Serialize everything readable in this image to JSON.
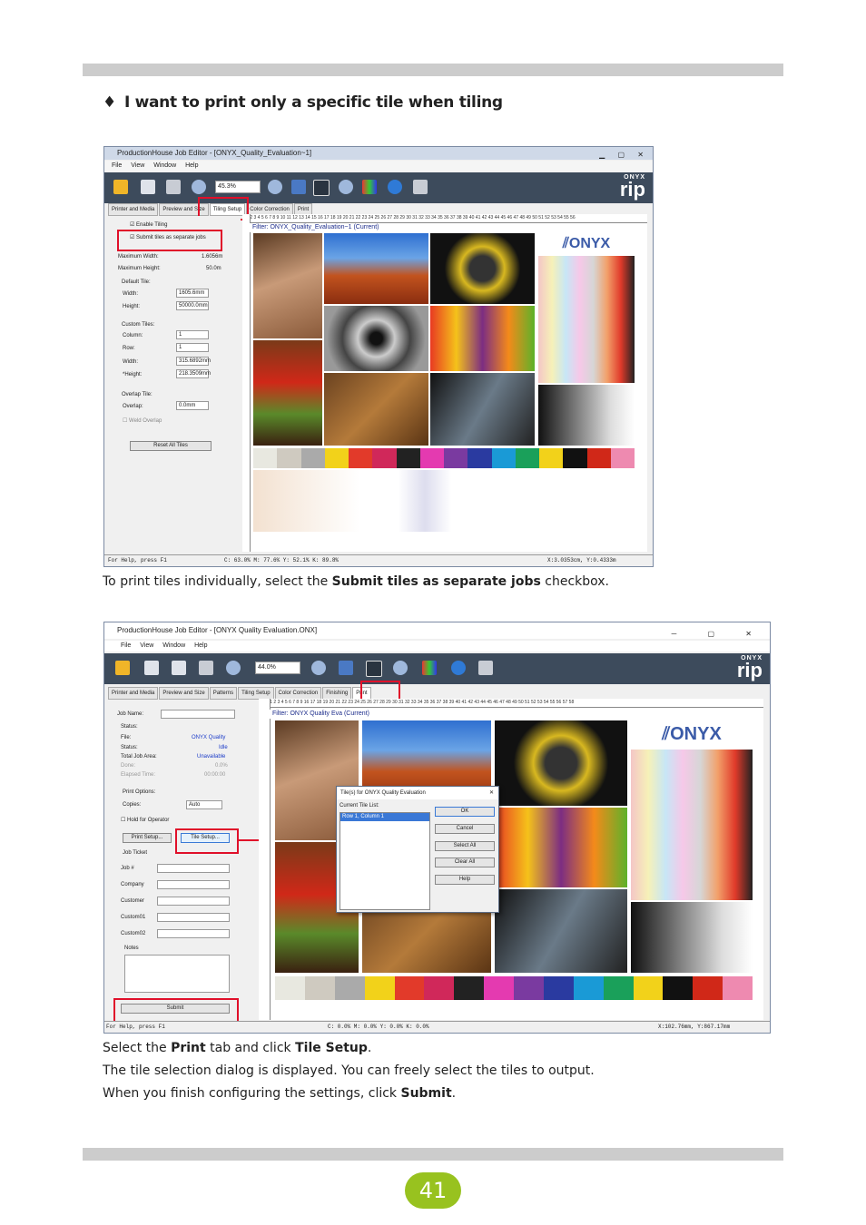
{
  "heading": {
    "bullet": "♦",
    "text": "I want to print only a specific tile when tiling"
  },
  "shot1": {
    "title": "ProductionHouse Job Editor - [ONYX_Quality_Evaluation~1]",
    "menu": [
      "File",
      "View",
      "Window",
      "Help"
    ],
    "zoom": "45.3%",
    "logo_brand": "ONYX",
    "logo_product": "rip",
    "tabs": [
      "Printer and Media",
      "Preview and Size",
      "Tiling Setup",
      "Color Correction",
      "Print"
    ],
    "enable_tiling": "Enable Tiling",
    "submit_tiles": "Submit tiles as separate jobs",
    "max_width_label": "Maximum Width:",
    "max_width": "1.6056m",
    "max_height_label": "Maximum Height:",
    "max_height": "50.0m",
    "default_tile": "Default Tile:",
    "width_label": "Width:",
    "width": "1605.6mm",
    "height_label": "Height:",
    "height": "50000.0mm",
    "custom_tiles": "Custom Tiles:",
    "column_label": "Column:",
    "column": "1",
    "row_label": "Row:",
    "row": "1",
    "cwidth_label": "Width:",
    "cwidth": "315.6892mm",
    "cheight_label": "*Height:",
    "cheight": "218.3509mm",
    "overlap_tile": "Overlap Tile:",
    "overlap_label": "Overlap:",
    "overlap": "0.0mm",
    "weld_overlap": "Weld Overlap",
    "reset": "Reset All Tiles",
    "ruler": "0 1 2 3 4 5 6 7 8 9 10 11 12 13 14 15 16 17 18 19 20 21 22 23 24 25 26 27 28 29 30 31 32 33 34 35 36 37 38 39 40 41 42 43 44 45 46 47 48 49 50 51 52 53 54 55 56",
    "filter": "Filter: ONYX_Quality_Evaluation~1 (Current)",
    "status_help": "For Help, press F1",
    "status_color": "C: 63.0% M: 77.6% Y: 52.1% K: 89.8%",
    "status_xy": "X:3.0353cm, Y:0.4333m"
  },
  "caption1": {
    "pre": "To print tiles individually, select the ",
    "bold": "Submit tiles as separate jobs",
    "post": " checkbox."
  },
  "shot2": {
    "title": "ProductionHouse Job Editor - [ONYX Quality Evaluation.ONX]",
    "menu": [
      "File",
      "View",
      "Window",
      "Help"
    ],
    "zoom": "44.0%",
    "logo_brand": "ONYX",
    "logo_product": "rip",
    "tabs": [
      "Printer and Media",
      "Preview and Size",
      "Patterns",
      "Tiling Setup",
      "Color Correction",
      "Finishing",
      "Print"
    ],
    "job_name": "Job Name:",
    "status_hdr": "Status:",
    "file_label": "File:",
    "file": "ONYX Quality",
    "status_label": "Status:",
    "status": "Idle",
    "total_label": "Total Job Area:",
    "total": "Unavailable",
    "done_label": "Done:",
    "done": "0.0%",
    "elapsed_label": "Elapsed Time:",
    "elapsed": "00:00:00",
    "print_options": "Print Options:",
    "copies_label": "Copies:",
    "copies": "Auto",
    "hold": "Hold for Operator",
    "print_setup": "Print Setup...",
    "tile_setup": "Tile Setup...",
    "job_ticket": "Job Ticket",
    "job_no": "Job #",
    "company": "Company",
    "customer": "Customer",
    "custom01": "Custom01",
    "custom02": "Custom02",
    "notes": "Notes",
    "submit": "Submit",
    "ruler": "cm 0 1 2 3 4 5 6 7 8 9 16 17 18 19 20 21 22 23 24 25 26 27 28 29 30 31 32 33 34 35 36 37 38 39 40 41 42 43 44 45 46 47 48 49 50 51 52 53 54 55 56 57 58",
    "filter": "Filter: ONYX Quality Eva (Current)",
    "dialog_title": "Tile(s) for ONYX Quality Evaluation",
    "dialog_close": "✕",
    "current_list": "Current Tile List:",
    "list_item": "Row 1, Column 1",
    "ok": "OK",
    "cancel": "Cancel",
    "select_all": "Select All",
    "clear_all": "Clear All",
    "help": "Help",
    "status_help": "For Help, press F1",
    "status_color": "C: 0.0% M: 0.0% Y: 0.0% K: 0.0%",
    "status_xy": "X:102.76mm, Y:867.17mm"
  },
  "caption2": {
    "pre": "Select the ",
    "bold1": "Print",
    "mid": " tab and click ",
    "bold2": "Tile Setup",
    "post": "."
  },
  "caption3": "The tile selection dialog is displayed. You can freely select the tiles to output.",
  "caption4": {
    "pre": "When you finish configuring the settings, click ",
    "bold": "Submit",
    "post": "."
  },
  "page_number": "41",
  "colors": {
    "accent_red": "#e0102a",
    "page_badge": "#98c21f",
    "toolbar": "#3d4b5c"
  }
}
